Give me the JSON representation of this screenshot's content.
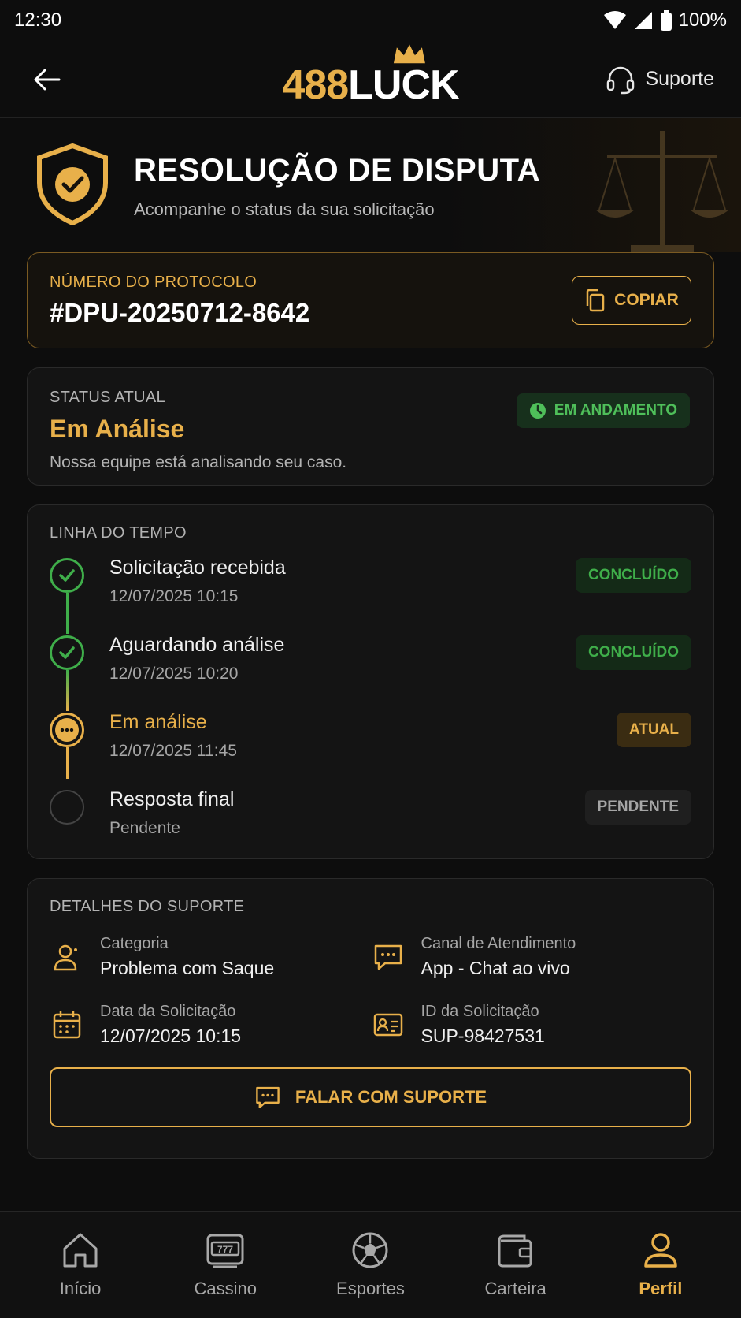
{
  "statusbar": {
    "time": "12:30",
    "battery": "100%"
  },
  "header": {
    "logo_num": "488",
    "logo_word": "LUCK",
    "support_label": "Suporte"
  },
  "hero": {
    "title": "RESOLUÇÃO DE DISPUTA",
    "subtitle": "Acompanhe o status da sua solicitação"
  },
  "protocol": {
    "label": "NÚMERO DO PROTOCOLO",
    "number": "#DPU-20250712-8642",
    "copy_label": "COPIAR"
  },
  "status": {
    "label": "STATUS ATUAL",
    "value": "Em Análise",
    "description": "Nossa equipe está analisando seu caso.",
    "badge": "EM ANDAMENTO"
  },
  "timeline": {
    "title": "LINHA DO TEMPO",
    "items": [
      {
        "title": "Solicitação recebida",
        "time": "12/07/2025 10:15",
        "badge": "CONCLUÍDO"
      },
      {
        "title": "Aguardando análise",
        "time": "12/07/2025 10:20",
        "badge": "CONCLUÍDO"
      },
      {
        "title": "Em análise",
        "time": "12/07/2025 11:45",
        "badge": "ATUAL"
      },
      {
        "title": "Resposta final",
        "time": "Pendente",
        "badge": "PENDENTE"
      }
    ]
  },
  "details": {
    "title": "DETALHES DO SUPORTE",
    "items": [
      {
        "label": "Categoria",
        "value": "Problema com Saque",
        "icon": "user-icon"
      },
      {
        "label": "Canal de Atendimento",
        "value": "App - Chat ao vivo",
        "icon": "chat-icon"
      },
      {
        "label": "Data da Solicitação",
        "value": "12/07/2025 10:15",
        "icon": "calendar-icon"
      },
      {
        "label": "ID da Solicitação",
        "value": "SUP-98427531",
        "icon": "id-card-icon"
      }
    ],
    "button_label": "FALAR COM SUPORTE"
  },
  "nav": {
    "items": [
      {
        "label": "Início",
        "icon": "home-icon"
      },
      {
        "label": "Cassino",
        "icon": "slot-machine-icon"
      },
      {
        "label": "Esportes",
        "icon": "soccer-ball-icon"
      },
      {
        "label": "Carteira",
        "icon": "wallet-icon"
      },
      {
        "label": "Perfil",
        "icon": "profile-icon"
      }
    ],
    "active": "Perfil"
  },
  "colors": {
    "accent": "#e8b04a",
    "success": "#3fae4a",
    "background": "#0d0d0d"
  }
}
